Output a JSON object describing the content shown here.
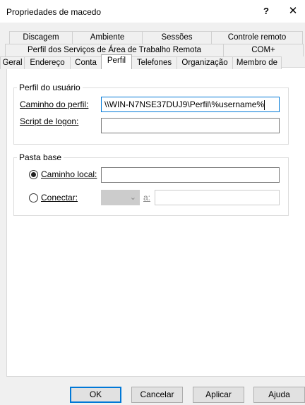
{
  "window": {
    "title": "Propriedades de macedo",
    "help_label": "?",
    "close_label": "✕"
  },
  "tabs": {
    "row1": [
      "Discagem",
      "Ambiente",
      "Sessões",
      "Controle remoto"
    ],
    "row2": [
      "Perfil dos Serviços de Área de Trabalho Remota",
      "COM+"
    ],
    "row3": [
      "Geral",
      "Endereço",
      "Conta",
      "Perfil",
      "Telefones",
      "Organização",
      "Membro de"
    ],
    "active": "Perfil"
  },
  "user_profile": {
    "legend": "Perfil do usuário",
    "profile_path_label": "Caminho do perfil:",
    "profile_path_value": "\\\\WIN-N7NSE37DUJ9\\Perfil\\%username%",
    "logon_script_label": "Script de logon:",
    "logon_script_value": ""
  },
  "home_folder": {
    "legend": "Pasta base",
    "local_path_label": "Caminho local:",
    "local_path_value": "",
    "local_path_selected": true,
    "connect_label": "Conectar:",
    "connect_drive_value": "",
    "to_label": "a:",
    "connect_target_value": ""
  },
  "buttons": {
    "ok": "OK",
    "cancel": "Cancelar",
    "apply": "Aplicar",
    "help": "Ajuda"
  }
}
